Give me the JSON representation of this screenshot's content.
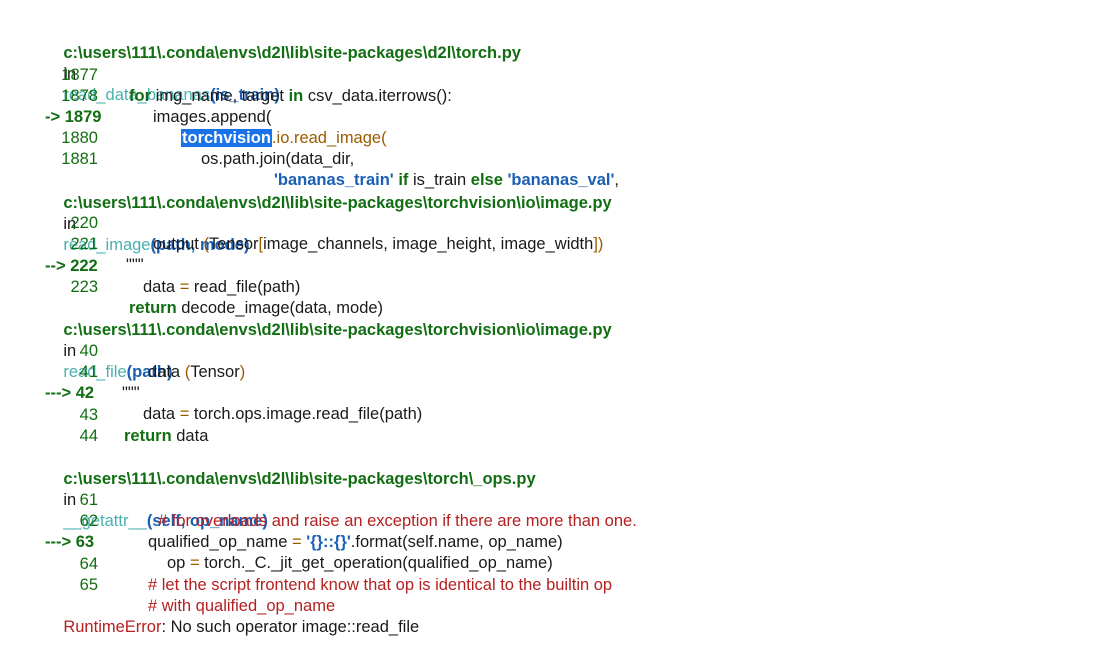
{
  "frames": [
    {
      "path": "c:\\users\\111\\.conda\\envs\\d2l\\lib\\site-packages\\d2l\\torch.py",
      "in_word": "in",
      "func": "read_data_bananas",
      "args": "(is_train)",
      "lines": [
        {
          "no": "1877",
          "segments": [
            {
              "t": "for",
              "c": "kw"
            },
            {
              "t": " img_name, target ",
              "c": ""
            },
            {
              "t": "in",
              "c": "kw"
            },
            {
              "t": " csv_data.iterrows():",
              "c": ""
            }
          ]
        },
        {
          "no": "1878",
          "segments": [
            {
              "t": "images.append(",
              "c": ""
            }
          ]
        },
        {
          "no": "-> 1879",
          "current": true,
          "segments": [
            {
              "t": "torchvision",
              "c": "sel"
            },
            {
              "t": ".io.read_image(",
              "c": "attr-tail"
            }
          ]
        },
        {
          "no": "1880",
          "segments": [
            {
              "t": "os.path.join(data_dir,",
              "c": ""
            }
          ]
        },
        {
          "no": "1881",
          "segments": [
            {
              "t": "'bananas_train'",
              "c": "str"
            },
            {
              "t": " ",
              "c": ""
            },
            {
              "t": "if",
              "c": "kw"
            },
            {
              "t": " is_train ",
              "c": ""
            },
            {
              "t": "else",
              "c": "kw"
            },
            {
              "t": " ",
              "c": ""
            },
            {
              "t": "'bananas_val'",
              "c": "str"
            },
            {
              "t": ",",
              "c": ""
            }
          ]
        }
      ]
    },
    {
      "path": "c:\\users\\111\\.conda\\envs\\d2l\\lib\\site-packages\\torchvision\\io\\image.py",
      "in_word": "in",
      "func": "read_image",
      "args": "(path, mode)",
      "lines": [
        {
          "no": "220",
          "segments": [
            {
              "t": "output ",
              "c": ""
            },
            {
              "t": "(",
              "c": "op"
            },
            {
              "t": "Tensor",
              "c": ""
            },
            {
              "t": "[",
              "c": "op"
            },
            {
              "t": "image_channels, image_height, image_width",
              "c": ""
            },
            {
              "t": "])",
              "c": "op"
            }
          ]
        },
        {
          "no": "221",
          "segments": [
            {
              "t": "\"\"\"",
              "c": ""
            }
          ]
        },
        {
          "no": "--> 222",
          "current": true,
          "segments": [
            {
              "t": "data ",
              "c": ""
            },
            {
              "t": "=",
              "c": "op"
            },
            {
              "t": " read_file(path)",
              "c": ""
            }
          ]
        },
        {
          "no": "223",
          "segments": [
            {
              "t": "return",
              "c": "kw"
            },
            {
              "t": " decode_image(data, mode)",
              "c": ""
            }
          ]
        }
      ]
    },
    {
      "path": "c:\\users\\111\\.conda\\envs\\d2l\\lib\\site-packages\\torchvision\\io\\image.py",
      "in_word": "in",
      "func": "read_file",
      "args": "(path)",
      "lines": [
        {
          "no": "40",
          "segments": [
            {
              "t": "data ",
              "c": ""
            },
            {
              "t": "(",
              "c": "op"
            },
            {
              "t": "Tensor",
              "c": ""
            },
            {
              "t": ")",
              "c": "op"
            }
          ]
        },
        {
          "no": "41",
          "segments": [
            {
              "t": "\"\"\"",
              "c": ""
            }
          ]
        },
        {
          "no": "---> 42",
          "current": true,
          "segments": [
            {
              "t": "data ",
              "c": ""
            },
            {
              "t": "=",
              "c": "op"
            },
            {
              "t": " torch.ops.image.read_file(path)",
              "c": ""
            }
          ]
        },
        {
          "no": "43",
          "segments": [
            {
              "t": "return",
              "c": "kw"
            },
            {
              "t": " data",
              "c": ""
            }
          ]
        },
        {
          "no": "44",
          "segments": []
        }
      ]
    },
    {
      "path": "c:\\users\\111\\.conda\\envs\\d2l\\lib\\site-packages\\torch\\_ops.py",
      "in_word": "in",
      "func": "__getattr__",
      "args": "(self, op_name)",
      "lines": [
        {
          "no": "61",
          "segments": [
            {
              "t": "# for overloads and raise an exception if there are more than one.",
              "c": "cm"
            }
          ]
        },
        {
          "no": "62",
          "segments": [
            {
              "t": "qualified_op_name ",
              "c": ""
            },
            {
              "t": "=",
              "c": "op"
            },
            {
              "t": " ",
              "c": ""
            },
            {
              "t": "'{}::{}'",
              "c": "str"
            },
            {
              "t": ".format(self.name, op_name)",
              "c": ""
            }
          ]
        },
        {
          "no": "---> 63",
          "current": true,
          "segments": [
            {
              "t": "op ",
              "c": ""
            },
            {
              "t": "=",
              "c": "op"
            },
            {
              "t": " torch._C._jit_get_operation(qualified_op_name)",
              "c": ""
            }
          ]
        },
        {
          "no": "64",
          "segments": [
            {
              "t": "# let the script frontend know that op is identical to the builtin op",
              "c": "cm"
            }
          ]
        },
        {
          "no": "65",
          "segments": [
            {
              "t": "# with qualified_op_name",
              "c": "cm"
            }
          ]
        }
      ]
    }
  ],
  "error": {
    "name": "RuntimeError",
    "message": ": No such operator image::read_file"
  }
}
